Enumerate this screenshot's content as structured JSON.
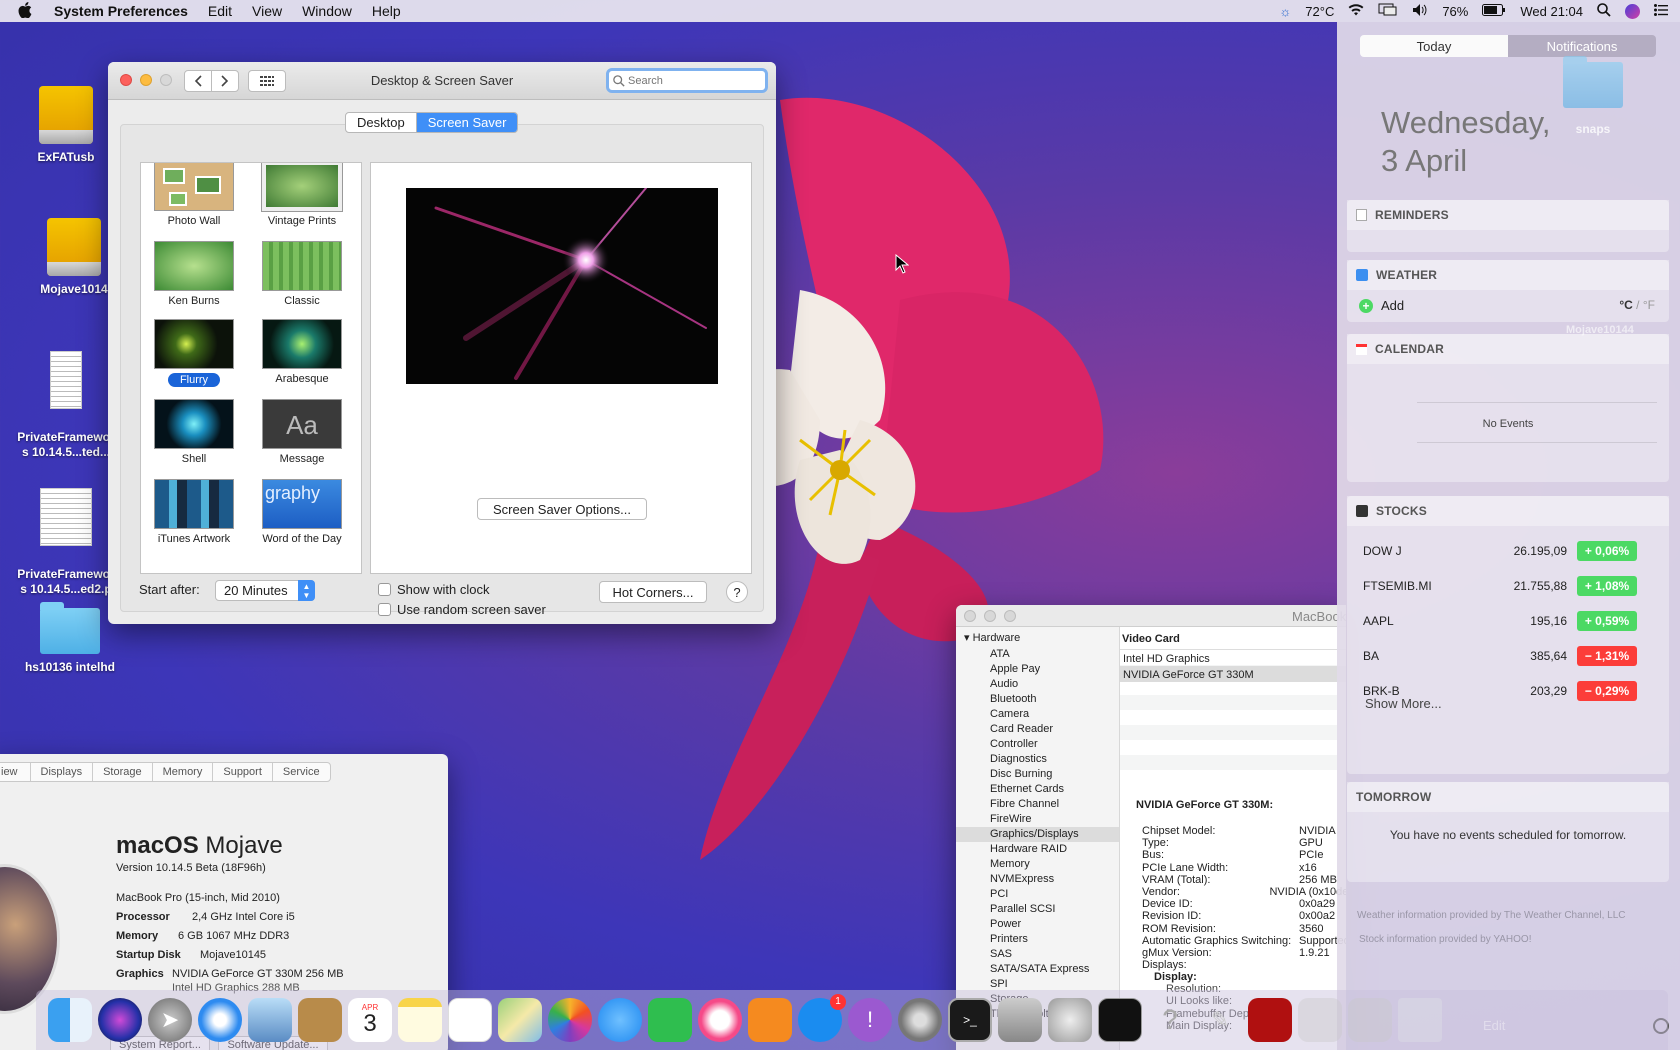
{
  "menubar": {
    "apple": "",
    "app": "System Preferences",
    "items": [
      "Edit",
      "View",
      "Window",
      "Help"
    ],
    "temp": "72°C",
    "battery": "76%",
    "clock": "Wed 21:04"
  },
  "desktop_icons": [
    {
      "label": "ExFATusb"
    },
    {
      "label": "Mojave1014"
    },
    {
      "label": "PrivateFramewor\ns 10.14.5...ted..."
    },
    {
      "label": "PrivateFramewor\ns 10.14.5...ed2.p"
    },
    {
      "label": "hs10136 intelhd"
    }
  ],
  "prefs": {
    "title": "Desktop & Screen Saver",
    "search_placeholder": "Search",
    "tabs": [
      "Desktop",
      "Screen Saver"
    ],
    "savers": [
      "Photo Wall",
      "Vintage Prints",
      "Ken Burns",
      "Classic",
      "Flurry",
      "Arabesque",
      "Shell",
      "Message",
      "iTunes Artwork",
      "Word of the Day"
    ],
    "message_text": "Aa",
    "word_text": "graphy",
    "options_button": "Screen Saver Options...",
    "start_after_label": "Start after:",
    "start_after_value": "20 Minutes",
    "show_with_clock": "Show with clock",
    "use_random": "Use random screen saver",
    "hot_corners": "Hot Corners...",
    "help": "?"
  },
  "about": {
    "tabs": [
      "iew",
      "Displays",
      "Storage",
      "Memory",
      "Support",
      "Service"
    ],
    "os_bold": "macOS",
    "os_name": "Mojave",
    "version": "Version 10.14.5 Beta (18F96h)",
    "model": "MacBook Pro (15-inch, Mid 2010)",
    "rows": [
      {
        "k": "Processor",
        "v": "2,4 GHz Intel Core i5"
      },
      {
        "k": "Memory",
        "v": "6 GB 1067 MHz DDR3"
      },
      {
        "k": "Startup Disk",
        "v": "Mojave10145"
      },
      {
        "k": "Graphics",
        "v": "NVIDIA GeForce GT 330M 256 MB"
      }
    ],
    "graphics2": "Intel HD Graphics 288 MB",
    "buttons": [
      "System Report...",
      "Software Update..."
    ]
  },
  "sysinfo": {
    "title": "MacBook",
    "tree_root": "Hardware",
    "tree": [
      "ATA",
      "Apple Pay",
      "Audio",
      "Bluetooth",
      "Camera",
      "Card Reader",
      "Controller",
      "Diagnostics",
      "Disc Burning",
      "Ethernet Cards",
      "Fibre Channel",
      "FireWire",
      "Graphics/Displays",
      "Hardware RAID",
      "Memory",
      "NVMExpress",
      "PCI",
      "Parallel SCSI",
      "Power",
      "Printers",
      "SAS",
      "SATA/SATA Express",
      "SPI",
      "Storage",
      "Thunderbolt"
    ],
    "selected": "Graphics/Displays",
    "col_header": "Video Card",
    "cards": [
      "Intel HD Graphics",
      "NVIDIA GeForce GT 330M"
    ],
    "detail_title": "NVIDIA GeForce GT 330M:",
    "details": [
      {
        "k": "Chipset Model:",
        "v": "NVIDIA"
      },
      {
        "k": "Type:",
        "v": "GPU"
      },
      {
        "k": "Bus:",
        "v": "PCIe"
      },
      {
        "k": "PCIe Lane Width:",
        "v": "x16"
      },
      {
        "k": "VRAM (Total):",
        "v": "256 MB"
      },
      {
        "k": "Vendor:",
        "v": "NVIDIA (0x10de)"
      },
      {
        "k": "Device ID:",
        "v": "0x0a29"
      },
      {
        "k": "Revision ID:",
        "v": "0x00a2"
      },
      {
        "k": "ROM Revision:",
        "v": "3560"
      },
      {
        "k": "Automatic Graphics Switching:",
        "v": "Supported"
      },
      {
        "k": "gMux Version:",
        "v": "1.9.21"
      },
      {
        "k": "Displays:",
        "v": ""
      }
    ],
    "display_sub": "Display:",
    "display_rows": [
      "Resolution:",
      "UI Looks like:",
      "Framebuffer Depth:",
      "Main Display:"
    ]
  },
  "nc": {
    "tabs": [
      "Today",
      "Notifications"
    ],
    "date1": "Wednesday,",
    "date2": "3 April",
    "folder_label": "snaps",
    "reminders": "REMINDERS",
    "weather": "WEATHER",
    "weather_add": "Add",
    "weather_c": "°C",
    "weather_sep": "/",
    "weather_f": "°F",
    "ghost_label": "Mojave10144",
    "calendar": "CALENDAR",
    "no_events": "No Events",
    "stocks": "STOCKS",
    "stock_rows": [
      {
        "s": "DOW J",
        "p": "26.195,09",
        "c": "+ 0,06%",
        "dir": "up"
      },
      {
        "s": "FTSEMIB.MI",
        "p": "21.755,88",
        "c": "+ 1,08%",
        "dir": "up"
      },
      {
        "s": "AAPL",
        "p": "195,16",
        "c": "+ 0,59%",
        "dir": "up"
      },
      {
        "s": "BA",
        "p": "385,64",
        "c": "− 1,31%",
        "dir": "dn"
      },
      {
        "s": "BRK-B",
        "p": "203,29",
        "c": "− 0,29%",
        "dir": "dn"
      }
    ],
    "show_more": "Show More...",
    "tomorrow": "TOMORROW",
    "tomorrow_text": "You have no events scheduled for tomorrow.",
    "credit1": "Weather information provided by The Weather Channel, LLC",
    "credit2": "Stock information provided by YAHOO!",
    "edit": "Edit"
  },
  "dock": {
    "calendar_month": "APR",
    "calendar_day": "3",
    "badge": "1"
  },
  "colors": {
    "accent": "#3f8ff7",
    "up": "#4cd964",
    "down": "#fc3d39"
  }
}
